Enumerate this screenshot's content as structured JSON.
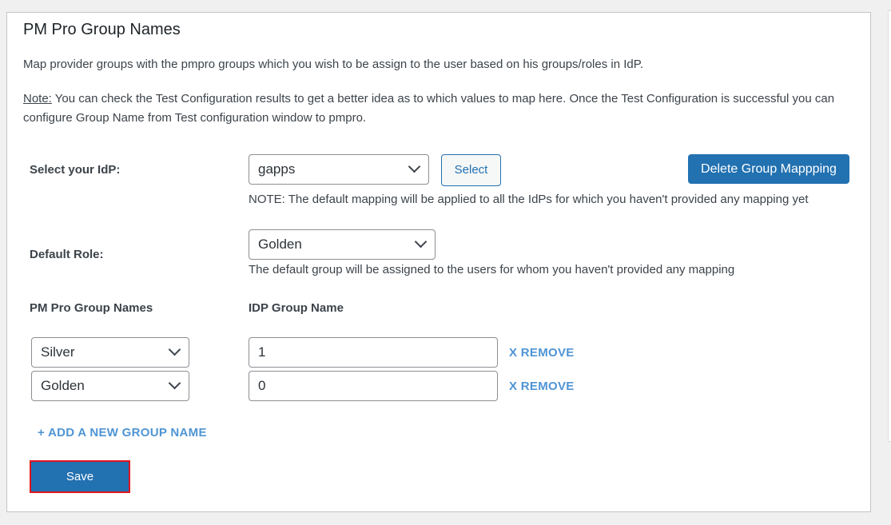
{
  "section": {
    "title": "PM Pro Group Names",
    "description": "Map provider groups with the pmpro groups which you wish to be assign to the user based on his groups/roles in IdP.",
    "note_label": "Note:",
    "note_text": " You can check the Test Configuration results to get a better idea as to which values to map here. Once the Test Configuration is successful you can configure Group Name from Test configuration window to pmpro."
  },
  "idp": {
    "label": "Select your IdP:",
    "selected": "gapps",
    "select_button": "Select",
    "delete_button": "Delete Group Mappping",
    "help": "NOTE: The default mapping will be applied to all the IdPs for which you haven't provided any mapping yet"
  },
  "default_role": {
    "label": "Default Role:",
    "selected": "Golden",
    "help": "The default group will be assigned to the users for whom you haven't provided any mapping"
  },
  "mapping": {
    "col_pmpro": "PM Pro Group Names",
    "col_idp": "IDP Group Name",
    "rows": [
      {
        "group": "Silver",
        "idp_value": "1",
        "remove_label": "X REMOVE"
      },
      {
        "group": "Golden",
        "idp_value": "0",
        "remove_label": "X REMOVE"
      }
    ],
    "add_label": "+ ADD A NEW GROUP NAME"
  },
  "save_label": "Save"
}
